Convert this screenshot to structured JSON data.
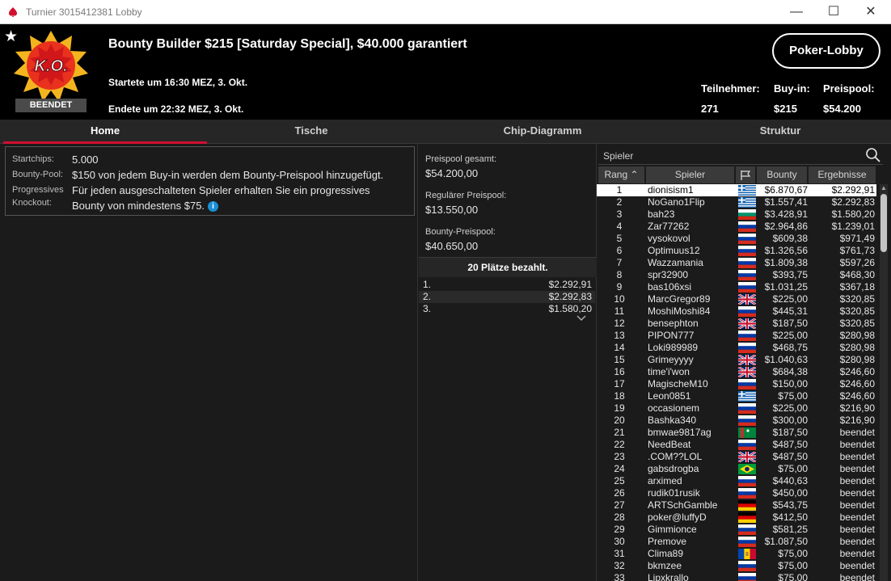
{
  "window": {
    "title": "Turnier 3015412381 Lobby",
    "minimize": "—",
    "maximize": "☐",
    "close": "✕"
  },
  "header": {
    "logo_text": "K.O.",
    "status_badge": "BEENDET",
    "title": "Bounty Builder $215 [Saturday Special], $40.000 garantiert",
    "started": "Startete um 16:30 MEZ, 3. Okt.",
    "ended": "Endete um 22:32 MEZ, 3. Okt.",
    "poker_lobby_button": "Poker-Lobby",
    "stats": {
      "participants_label": "Teilnehmer:",
      "participants_value": "271",
      "buyin_label": "Buy-in:",
      "buyin_value": "$215",
      "prizepool_label": "Preispool:",
      "prizepool_value": "$54.200"
    }
  },
  "tabs": [
    "Home",
    "Tische",
    "Chip-Diagramm",
    "Struktur"
  ],
  "home": {
    "startchips_label": "Startchips:",
    "startchips_value": "5.000",
    "bounty_pool_label": "Bounty-Pool:",
    "bounty_pool_value": "$150 von jedem Buy-in werden dem Bounty-Preispool hinzugefügt.",
    "progressive_label_1": "Progressives",
    "progressive_label_2": "Knockout:",
    "progressive_value_1": "Für jeden ausgeschalteten Spieler erhalten Sie ein progressives",
    "progressive_value_2": "Bounty von mindestens $75."
  },
  "prize": {
    "total_label": "Preispool gesamt:",
    "total_value": "$54.200,00",
    "regular_label": "Regulärer Preispool:",
    "regular_value": "$13.550,00",
    "bounty_label": "Bounty-Preispool:",
    "bounty_value": "$40.650,00",
    "paid_header": "20 Plätze bezahlt.",
    "paid": [
      {
        "pos": "1.",
        "amount": "$2.292,91"
      },
      {
        "pos": "2.",
        "amount": "$2.292,83"
      },
      {
        "pos": "3.",
        "amount": "$1.580,20"
      }
    ]
  },
  "players": {
    "search_placeholder": "Spieler",
    "columns": {
      "rank": "Rang",
      "player": "Spieler",
      "bounty": "Bounty",
      "result": "Ergebnisse"
    },
    "rows": [
      {
        "rank": "1",
        "name": "dionisism1",
        "flag": "gr",
        "bounty": "$6.870,67",
        "result": "$2.292,91"
      },
      {
        "rank": "2",
        "name": "NoGano1Flip",
        "flag": "gr",
        "bounty": "$1.557,41",
        "result": "$2.292,83"
      },
      {
        "rank": "3",
        "name": "bah23",
        "flag": "bg",
        "bounty": "$3.428,91",
        "result": "$1.580,20"
      },
      {
        "rank": "4",
        "name": "Zar77262",
        "flag": "ru",
        "bounty": "$2.964,86",
        "result": "$1.239,01"
      },
      {
        "rank": "5",
        "name": "vysokovol",
        "flag": "ru",
        "bounty": "$609,38",
        "result": "$971,49"
      },
      {
        "rank": "6",
        "name": "Optimuus12",
        "flag": "ru",
        "bounty": "$1.326,56",
        "result": "$761,73"
      },
      {
        "rank": "7",
        "name": "Wazzamania",
        "flag": "ru",
        "bounty": "$1.809,38",
        "result": "$597,26"
      },
      {
        "rank": "8",
        "name": "spr32900",
        "flag": "ru",
        "bounty": "$393,75",
        "result": "$468,30"
      },
      {
        "rank": "9",
        "name": "bas106xsi",
        "flag": "ru",
        "bounty": "$1.031,25",
        "result": "$367,18"
      },
      {
        "rank": "10",
        "name": "MarcGregor89",
        "flag": "gb",
        "bounty": "$225,00",
        "result": "$320,85"
      },
      {
        "rank": "11",
        "name": "MoshiMoshi84",
        "flag": "ru",
        "bounty": "$445,31",
        "result": "$320,85"
      },
      {
        "rank": "12",
        "name": "bensephton",
        "flag": "gb",
        "bounty": "$187,50",
        "result": "$320,85"
      },
      {
        "rank": "13",
        "name": "PIPON777",
        "flag": "ru",
        "bounty": "$225,00",
        "result": "$280,98"
      },
      {
        "rank": "14",
        "name": "Loki989989",
        "flag": "ru",
        "bounty": "$468,75",
        "result": "$280,98"
      },
      {
        "rank": "15",
        "name": "Grimeyyyy",
        "flag": "gb",
        "bounty": "$1.040,63",
        "result": "$280,98"
      },
      {
        "rank": "16",
        "name": "time'i'won",
        "flag": "gb",
        "bounty": "$684,38",
        "result": "$246,60"
      },
      {
        "rank": "17",
        "name": "MagischeM10",
        "flag": "ru",
        "bounty": "$150,00",
        "result": "$246,60"
      },
      {
        "rank": "18",
        "name": "Leon0851",
        "flag": "gr",
        "bounty": "$75,00",
        "result": "$246,60"
      },
      {
        "rank": "19",
        "name": "occasionem",
        "flag": "ru",
        "bounty": "$225,00",
        "result": "$216,90"
      },
      {
        "rank": "20",
        "name": "Bashka340",
        "flag": "ru",
        "bounty": "$300,00",
        "result": "$216,90"
      },
      {
        "rank": "21",
        "name": "bmwae9817ag",
        "flag": "tm",
        "bounty": "$187,50",
        "result": "beendet"
      },
      {
        "rank": "22",
        "name": "NeedBeat",
        "flag": "ru",
        "bounty": "$487,50",
        "result": "beendet"
      },
      {
        "rank": "23",
        "name": ".COM??LOL",
        "flag": "gb",
        "bounty": "$487,50",
        "result": "beendet"
      },
      {
        "rank": "24",
        "name": "gabsdrogba",
        "flag": "br",
        "bounty": "$75,00",
        "result": "beendet"
      },
      {
        "rank": "25",
        "name": "arximed",
        "flag": "ru",
        "bounty": "$440,63",
        "result": "beendet"
      },
      {
        "rank": "26",
        "name": "rudik01rusik",
        "flag": "ru",
        "bounty": "$450,00",
        "result": "beendet"
      },
      {
        "rank": "27",
        "name": "ARTSchGamble",
        "flag": "de",
        "bounty": "$543,75",
        "result": "beendet"
      },
      {
        "rank": "28",
        "name": "poker@luffyD",
        "flag": "de",
        "bounty": "$412,50",
        "result": "beendet"
      },
      {
        "rank": "29",
        "name": "Gimmionce",
        "flag": "ru",
        "bounty": "$581,25",
        "result": "beendet"
      },
      {
        "rank": "30",
        "name": "Premove",
        "flag": "ru",
        "bounty": "$1.087,50",
        "result": "beendet"
      },
      {
        "rank": "31",
        "name": "Clima89",
        "flag": "md",
        "bounty": "$75,00",
        "result": "beendet"
      },
      {
        "rank": "32",
        "name": "bkmzee",
        "flag": "ru",
        "bounty": "$75,00",
        "result": "beendet"
      },
      {
        "rank": "33",
        "name": "Lipxkrallo",
        "flag": "ru",
        "bounty": "$75,00",
        "result": "beendet"
      }
    ]
  },
  "colors": {
    "accent": "#d01030",
    "background": "#1b1b1b",
    "header_bg": "#000000",
    "selected_row": "#ffffff"
  }
}
